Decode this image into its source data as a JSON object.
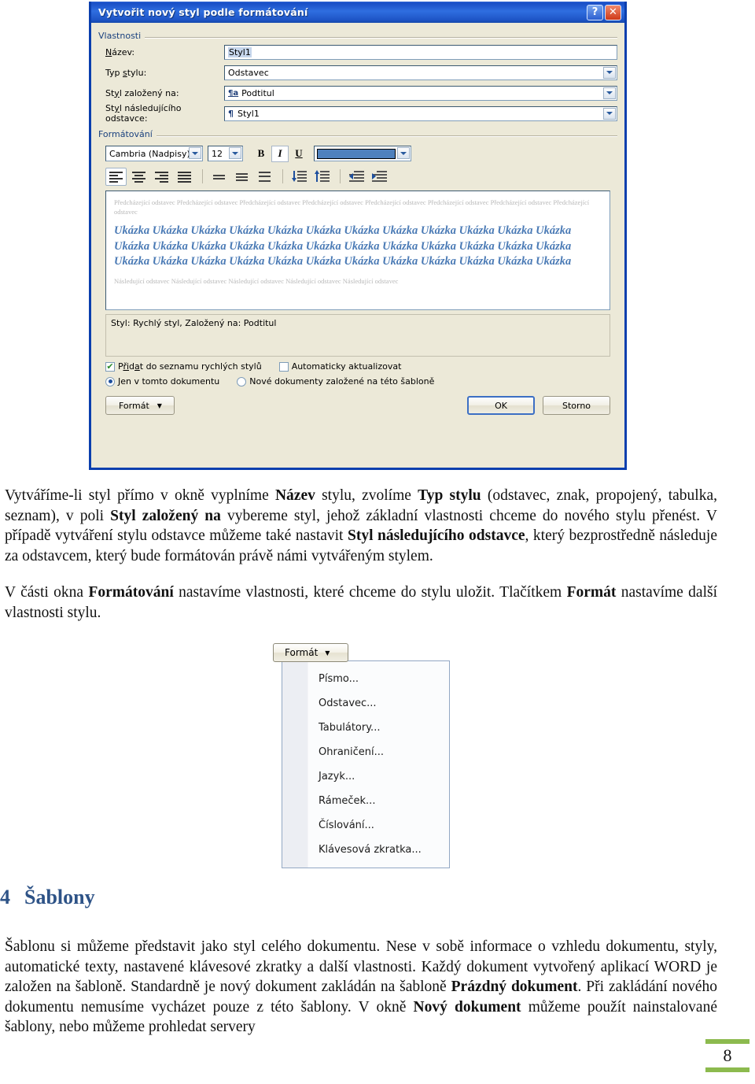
{
  "dialog": {
    "title": "Vytvořit nový styl podle formátování",
    "help_button": "?",
    "close_button": "✕",
    "groups": {
      "properties_label": "Vlastnosti",
      "formatting_label": "Formátování"
    },
    "fields": [
      {
        "label": "Název:",
        "value": "Styl1",
        "type": "text",
        "icon": ""
      },
      {
        "label": "Typ stylu:",
        "value": "Odstavec",
        "type": "combo",
        "icon": ""
      },
      {
        "label": "Styl založený na:",
        "value": "Podtitul",
        "type": "combo",
        "icon": "style-icon"
      },
      {
        "label": "Styl následujícího odstavce:",
        "value": "Styl1",
        "type": "combo",
        "icon": "pilcrow-icon"
      }
    ],
    "formatting": {
      "font_family": "Cambria (Nadpisy)",
      "font_size": "12",
      "bold_label": "B",
      "italic_label": "I",
      "underline_label": "U",
      "font_color": "#4f81bd"
    },
    "preview": {
      "before_text": "Předcházející odstavec Předcházející odstavec Předcházející odstavec Předcházející odstavec Předcházející odstavec Předcházející odstavec Předcházející odstavec Předcházející odstavec",
      "sample_text": "Ukázka Ukázka Ukázka Ukázka Ukázka Ukázka Ukázka Ukázka Ukázka Ukázka Ukázka Ukázka Ukázka Ukázka Ukázka Ukázka Ukázka Ukázka Ukázka Ukázka Ukázka Ukázka Ukázka Ukázka Ukázka Ukázka Ukázka Ukázka Ukázka Ukázka Ukázka Ukázka Ukázka Ukázka Ukázka Ukázka",
      "after_text": "Následující odstavec Následující odstavec Následující odstavec Následující odstavec Následující odstavec"
    },
    "description": "Styl: Rychlý styl, Založený na: Podtitul",
    "options": {
      "add_to_quick_styles": "Přidat do seznamu rychlých stylů",
      "auto_update": "Automaticky aktualizovat",
      "only_this_document": "Jen v tomto dokumentu",
      "new_documents": "Nové dokumenty založené na této šabloně"
    },
    "buttons": {
      "format": "Formát",
      "ok": "OK",
      "cancel": "Storno"
    }
  },
  "format_menu": {
    "button_label": "Formát",
    "items": [
      {
        "label": "Písmo...",
        "accel": "P"
      },
      {
        "label": "Odstavec...",
        "accel": "c"
      },
      {
        "label": "Tabulátory...",
        "accel": "T"
      },
      {
        "label": "Ohraničení...",
        "accel": "h"
      },
      {
        "label": "Jazyk...",
        "accel": "J"
      },
      {
        "label": "Rámeček...",
        "accel": "R"
      },
      {
        "label": "Číslování...",
        "accel": "s"
      },
      {
        "label": "Klávesová zkratka...",
        "accel": "K"
      }
    ]
  },
  "document": {
    "paragraph1": {
      "s1": "Vytváříme-li styl přímo v okně vyplníme ",
      "b1": "Název",
      "s2": " stylu, zvolíme ",
      "b2": "Typ stylu",
      "s3": " (odstavec, znak, propojený, tabulka, seznam), v poli ",
      "b3": "Styl založený na",
      "s4": " vybereme styl, jehož základní vlastnosti chceme do nového stylu přenést. V případě vytváření stylu odstavce můžeme také nastavit ",
      "b4": "Styl následujícího odstavce",
      "s5": ", který bezprostředně následuje za odstavcem, který bude formátován právě námi vytvářeným stylem."
    },
    "paragraph2": {
      "s1": "V části okna ",
      "b1": "Formátování",
      "s2": " nastavíme vlastnosti, které chceme do stylu uložit. Tlačítkem ",
      "b2": "Formát",
      "s3": " nastavíme další vlastnosti stylu."
    },
    "heading": {
      "number": "4",
      "text": "Šablony"
    },
    "paragraph3": {
      "s1": "Šablonu si můžeme představit jako styl celého dokumentu. Nese v sobě informace o vzhledu dokumentu, styly, automatické texty, nastavené klávesové zkratky a další vlastnosti. Každý dokument vytvořený aplikací WORD je založen na šabloně. Standardně je nový dokument zakládán na šabloně ",
      "b1": "Prázdný dokument",
      "s2": ". Při zakládání nového dokumentu nemusíme vycházet pouze z této šablony. V okně ",
      "b2": "Nový dokument",
      "s3": " můžeme použít nainstalované šablony, nebo můžeme prohledat servery"
    },
    "page_number": "8"
  },
  "colors": {
    "titlebar": "#1d53c4",
    "dialog_face": "#ece9d8",
    "heading": "#2e5387",
    "preview_text": "#4a7ab5",
    "footer_bar": "#8cba4e"
  }
}
